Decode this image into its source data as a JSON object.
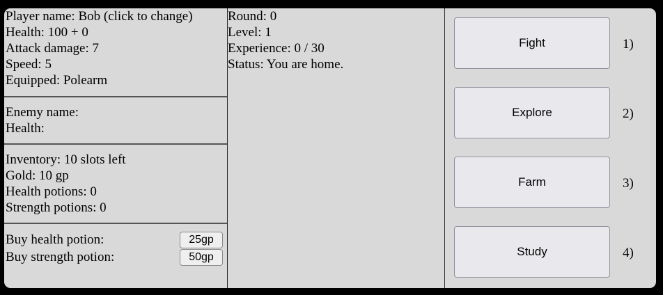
{
  "player": {
    "name_line": "Player name: Bob (click to change)",
    "health": "Health: 100 + 0",
    "attack": "Attack damage: 7",
    "speed": "Speed: 5",
    "equipped": "Equipped: Polearm"
  },
  "enemy": {
    "name": "Enemy name:",
    "health": "Health:"
  },
  "inventory": {
    "slots": "Inventory: 10 slots left",
    "gold": "Gold: 10 gp",
    "health_potions": "Health potions: 0",
    "strength_potions": "Strength potions: 0"
  },
  "shop": {
    "health_label": "Buy health potion:",
    "health_price": "25gp",
    "strength_label": "Buy strength potion:",
    "strength_price": "50gp"
  },
  "status": {
    "round": "Round: 0",
    "level": "Level: 1",
    "experience": "Experience: 0 / 30",
    "status": "Status: You are home."
  },
  "actions": [
    {
      "label": "Fight",
      "hotkey": "1)"
    },
    {
      "label": "Explore",
      "hotkey": "2)"
    },
    {
      "label": "Farm",
      "hotkey": "3)"
    },
    {
      "label": "Study",
      "hotkey": "4)"
    }
  ]
}
